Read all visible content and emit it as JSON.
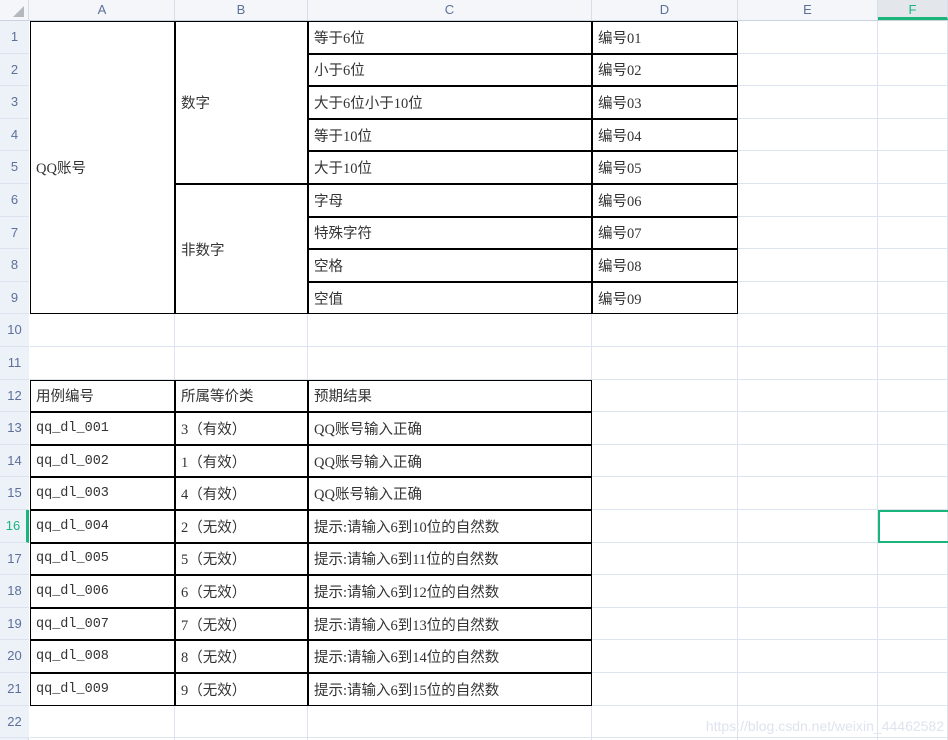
{
  "app": {
    "type": "spreadsheet",
    "accent_color": "#19B57B",
    "grid_line_color": "#DDE4EF",
    "header_bg": "#F4F6F9",
    "header_text_color": "#5C7099"
  },
  "columns": [
    {
      "label": "A",
      "selected": false
    },
    {
      "label": "B",
      "selected": false
    },
    {
      "label": "C",
      "selected": false
    },
    {
      "label": "D",
      "selected": false
    },
    {
      "label": "E",
      "selected": false
    },
    {
      "label": "F",
      "selected": true
    }
  ],
  "rows": [
    {
      "label": "1",
      "selected": false
    },
    {
      "label": "2",
      "selected": false
    },
    {
      "label": "3",
      "selected": false
    },
    {
      "label": "4",
      "selected": false
    },
    {
      "label": "5",
      "selected": false
    },
    {
      "label": "6",
      "selected": false
    },
    {
      "label": "7",
      "selected": false
    },
    {
      "label": "8",
      "selected": false
    },
    {
      "label": "9",
      "selected": false
    },
    {
      "label": "10",
      "selected": false
    },
    {
      "label": "11",
      "selected": false
    },
    {
      "label": "12",
      "selected": false
    },
    {
      "label": "13",
      "selected": false
    },
    {
      "label": "14",
      "selected": false
    },
    {
      "label": "15",
      "selected": false
    },
    {
      "label": "16",
      "selected": true
    },
    {
      "label": "17",
      "selected": false
    },
    {
      "label": "18",
      "selected": false
    },
    {
      "label": "19",
      "selected": false
    },
    {
      "label": "20",
      "selected": false
    },
    {
      "label": "21",
      "selected": false
    },
    {
      "label": "22",
      "selected": false
    }
  ],
  "active_cell": "F16",
  "table_equivalence": {
    "merged_a": "QQ账号",
    "group_numeric": "数字",
    "group_nonnumeric": "非数字",
    "entries": [
      {
        "condition": "等于6位",
        "code": "编号01"
      },
      {
        "condition": "小于6位",
        "code": "编号02"
      },
      {
        "condition": "大于6位小于10位",
        "code": "编号03"
      },
      {
        "condition": "等于10位",
        "code": "编号04"
      },
      {
        "condition": "大于10位",
        "code": "编号05"
      },
      {
        "condition": "字母",
        "code": "编号06"
      },
      {
        "condition": "特殊字符",
        "code": "编号07"
      },
      {
        "condition": "空格",
        "code": "编号08"
      },
      {
        "condition": "空值",
        "code": "编号09"
      }
    ]
  },
  "table_cases": {
    "headers": [
      "用例编号",
      "所属等价类",
      "预期结果"
    ],
    "rows": [
      {
        "id": "qq_dl_001",
        "klass": "3（有效）",
        "expected": "QQ账号输入正确"
      },
      {
        "id": "qq_dl_002",
        "klass": "1（有效）",
        "expected": "QQ账号输入正确"
      },
      {
        "id": "qq_dl_003",
        "klass": "4（有效）",
        "expected": "QQ账号输入正确"
      },
      {
        "id": "qq_dl_004",
        "klass": "2（无效）",
        "expected": "提示:请输入6到10位的自然数"
      },
      {
        "id": "qq_dl_005",
        "klass": "5（无效）",
        "expected": "提示:请输入6到11位的自然数"
      },
      {
        "id": "qq_dl_006",
        "klass": "6（无效）",
        "expected": "提示:请输入6到12位的自然数"
      },
      {
        "id": "qq_dl_007",
        "klass": "7（无效）",
        "expected": "提示:请输入6到13位的自然数"
      },
      {
        "id": "qq_dl_008",
        "klass": "8（无效）",
        "expected": "提示:请输入6到14位的自然数"
      },
      {
        "id": "qq_dl_009",
        "klass": "9（无效）",
        "expected": "提示:请输入6到15位的自然数"
      }
    ]
  },
  "watermark": "https://blog.csdn.net/weixin_44462582"
}
